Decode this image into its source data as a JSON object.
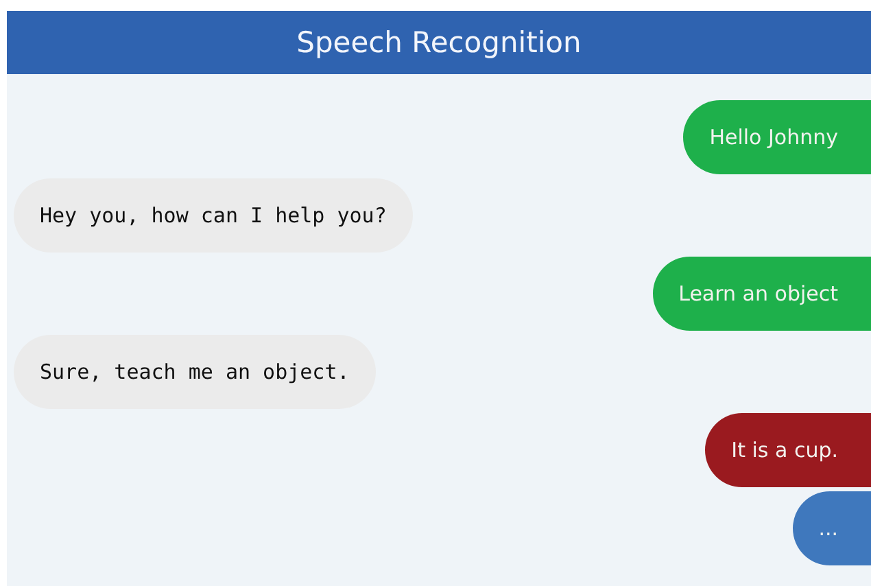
{
  "header": {
    "title": "Speech Recognition"
  },
  "messages": [
    {
      "kind": "user",
      "text": "Hello Johnny",
      "color": "#1eb04b"
    },
    {
      "kind": "bot",
      "text": "Hey you, how can I help you?"
    },
    {
      "kind": "user",
      "text": "Learn an object",
      "color": "#1eb04b"
    },
    {
      "kind": "bot",
      "text": "Sure, teach me an object."
    },
    {
      "kind": "user",
      "text": "It is a cup.",
      "color": "#9a1a1f"
    },
    {
      "kind": "user",
      "text": "...",
      "color": "#3f78bd"
    }
  ]
}
